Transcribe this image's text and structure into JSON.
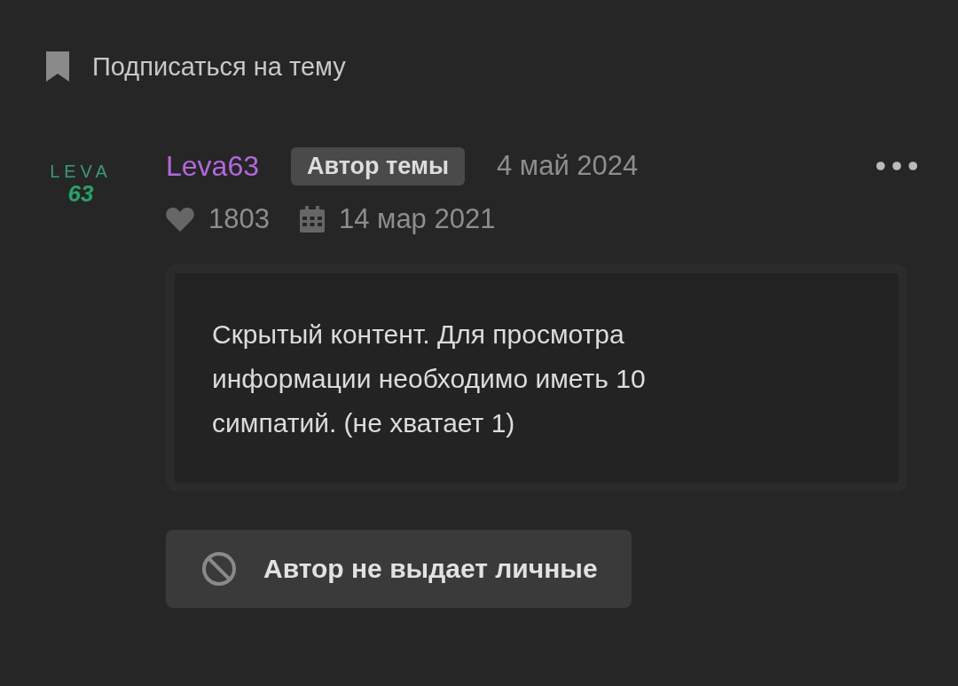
{
  "subscribe": {
    "label": "Подписаться на тему"
  },
  "post": {
    "avatar": {
      "line_1": "LEVA",
      "line_2": "63"
    },
    "author": "Leva63",
    "badge": "Автор темы",
    "date": "4 май 2024",
    "likes": "1803",
    "joined": "14 мар 2021",
    "hidden_notice": "Скрытый контент. Для просмотра информации необходимо иметь 10 симпатий. (не хватает 1)",
    "notice_button": "Автор не выдает личные"
  }
}
